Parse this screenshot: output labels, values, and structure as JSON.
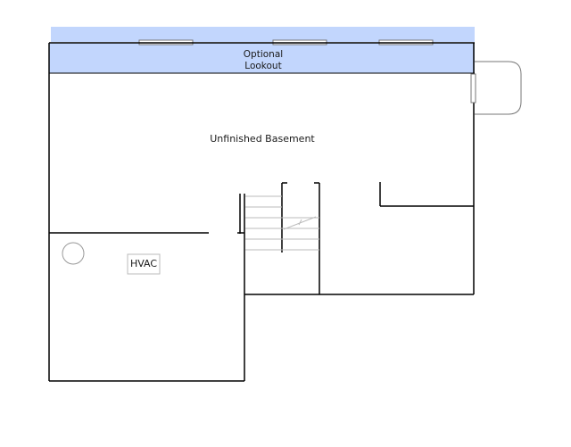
{
  "floor_plan": {
    "lookout_label_line1": "Optional",
    "lookout_label_line2": "Lookout",
    "basement_label": "Unfinished Basement",
    "hvac_label": "HVAC",
    "colors": {
      "lookout_fill": "#c2d6fd",
      "wall": "#000000",
      "stair_lines": "#bbbbbb",
      "window": "#ffffff"
    }
  }
}
